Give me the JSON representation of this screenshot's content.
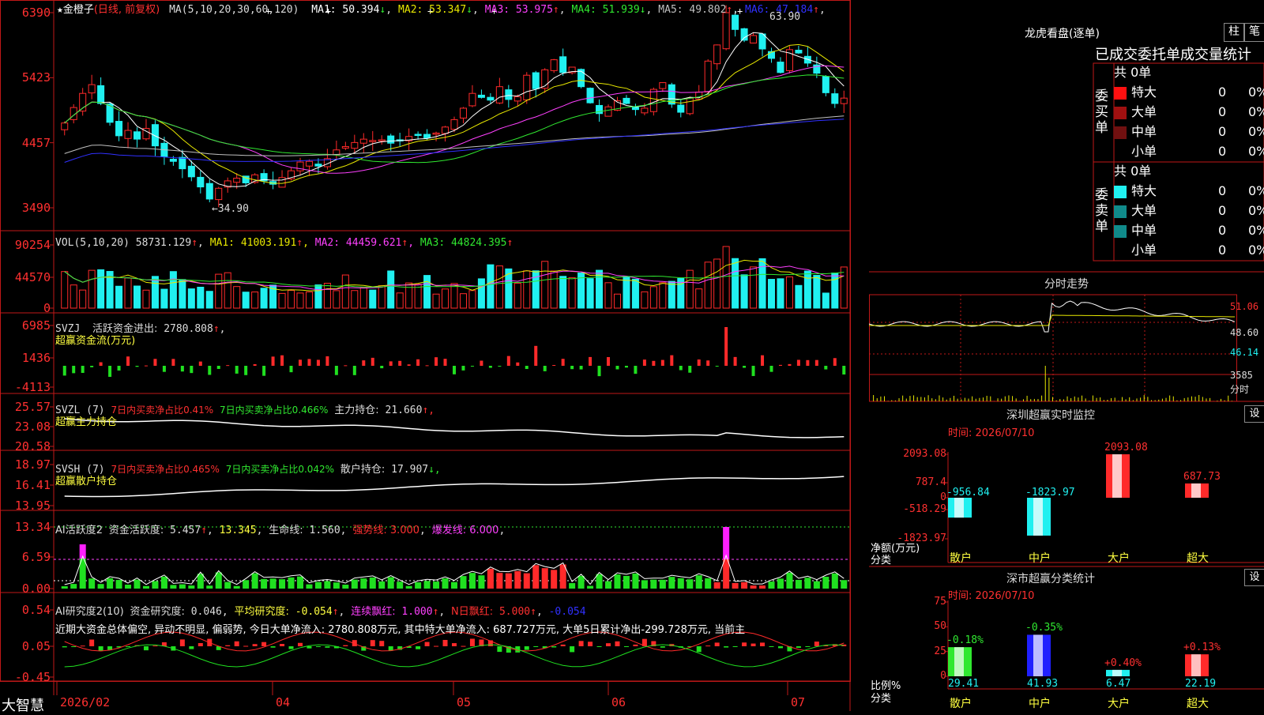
{
  "colors": {
    "up": "#ff2a2a",
    "down": "#20f0f0",
    "panel_border": "#c01818",
    "ma1": "#ffffff",
    "ma2": "#e8e800",
    "ma3": "#ff40ff",
    "ma4": "#30e830",
    "ma5": "#c0c0c0",
    "ma6": "#3030ff",
    "red_text": "#ff3030",
    "yellow_text": "#ffff40"
  },
  "stock": {
    "star": "★",
    "name": "金橙子",
    "mode": "(日线, 前复权)"
  },
  "main_panel": {
    "ma_header": "MA(5,10,20,30,60,120)",
    "ma_values": [
      {
        "label": "MA1:",
        "value": "50.394",
        "arrow": "↓",
        "color": "#ffffff"
      },
      {
        "label": "MA2:",
        "value": "53.347",
        "arrow": "↓",
        "color": "#e8e800"
      },
      {
        "label": "MA3:",
        "value": "53.975",
        "arrow": "↑",
        "color": "#ff40ff"
      },
      {
        "label": "MA4:",
        "value": "51.939",
        "arrow": "↓",
        "color": "#30e830"
      },
      {
        "label": "MA5:",
        "value": "49.802",
        "arrow": "↑",
        "color": "#c0c0c0"
      },
      {
        "label": "MA6:",
        "value": "47.184",
        "arrow": "↑",
        "color": "#3030ff"
      }
    ],
    "y_ticks": [
      "6390",
      "5423",
      "4457",
      "3490"
    ],
    "high_label": "63.90",
    "low_label": "←34.90"
  },
  "vol_panel": {
    "header": "VOL(5,10,20)",
    "value": "58731.129",
    "arrow": "↑",
    "ma": [
      {
        "label": "MA1:",
        "value": "41003.191",
        "arrow": "↑"
      },
      {
        "label": "MA2:",
        "value": "44459.621",
        "arrow": "↑"
      },
      {
        "label": "MA3:",
        "value": "44824.395",
        "arrow": "↑"
      }
    ],
    "y_ticks": [
      "90254",
      "44570",
      "0"
    ]
  },
  "svzj_panel": {
    "header": "SVZJ",
    "label": "活跃资金进出:",
    "value": "2780.808",
    "arrow": "↑",
    "subtitle": "超赢资金流(万元)",
    "y_ticks": [
      "6985",
      "1436",
      "-4113"
    ]
  },
  "svzl_panel": {
    "header": "SVZL (7)",
    "t1": "7日内买卖净占比0.41%",
    "t2": "7日内买卖净占比0.466%",
    "label": "主力持仓:",
    "value": "21.660",
    "arrow": "↑,",
    "subtitle": "超赢主力持仓",
    "y_ticks": [
      "25.57",
      "23.08",
      "20.58"
    ]
  },
  "svsh_panel": {
    "header": "SVSH (7)",
    "t1": "7日内买卖净占比0.465%",
    "t2": "7日内买卖净占比0.042%",
    "label": "散户持仓:",
    "value": "17.907",
    "arrow": "↓,",
    "subtitle": "超赢散户持仓",
    "y_ticks": [
      "18.97",
      "16.41",
      "13.95"
    ]
  },
  "ai_active_panel": {
    "header": "AI活跃度2",
    "label": "资金活跃度:",
    "value": "5.457",
    "v2": "13.345",
    "label3": "生命线:",
    "v3": "1.560",
    "t4": "强势线: 3.000",
    "t5": "爆发线: 6.000",
    "y_ticks": [
      "13.34",
      "6.59",
      "0.00"
    ]
  },
  "ai_research_panel": {
    "header": "AI研究度2(10)",
    "label": "资金研究度:",
    "value": "0.046",
    "t2": "平均研究度:",
    "v2": "-0.054",
    "t3": "连续飘红:",
    "v3": "1.000",
    "t4": "N日飘红:",
    "v4": "5.000",
    "v5": "-0.054",
    "comment": "近期大资金总体偏空, 异动不明显, 偏弱势, 今日大单净流入: 2780.808万元, 其中特大单净流入: 687.727万元, 大单5日累计净出-299.728万元, 当前主",
    "y_ticks": [
      "0.54",
      "0.05",
      "-0.45"
    ]
  },
  "x_axis": {
    "labels": [
      "2026/02",
      "04",
      "05",
      "06",
      "07"
    ],
    "brand": "大智慧"
  },
  "dragon_tiger": {
    "title": "龙虎看盘(逐单)",
    "btn1": "柱",
    "btn2": "笔",
    "header": "已成交委托单成交量统计",
    "buy": {
      "side": "委买单",
      "total": "共 0单",
      "rows": [
        {
          "label": "特大",
          "count": "0",
          "pct": "0%",
          "color": "#ff1010"
        },
        {
          "label": "大单",
          "count": "0",
          "pct": "0%",
          "color": "#a01010"
        },
        {
          "label": "中单",
          "count": "0",
          "pct": "0%",
          "color": "#701010"
        },
        {
          "label": "小单",
          "count": "0",
          "pct": "0%",
          "color": ""
        }
      ]
    },
    "sell": {
      "side": "委卖单",
      "total": "共 0单",
      "rows": [
        {
          "label": "特大",
          "count": "0",
          "pct": "0%",
          "color": "#20f0f0"
        },
        {
          "label": "大单",
          "count": "0",
          "pct": "0%",
          "color": "#108a8a"
        },
        {
          "label": "中单",
          "count": "0",
          "pct": "0%",
          "color": "#108a8a"
        },
        {
          "label": "小单",
          "count": "0",
          "pct": "0%",
          "color": ""
        }
      ]
    }
  },
  "intraday": {
    "title": "分时走势",
    "y_ticks": [
      "51.06",
      "48.60",
      "46.14",
      "3585",
      "分时"
    ]
  },
  "sz_monitor": {
    "title": "深圳超赢实时监控",
    "btn": "设",
    "time": "时间: 2026/07/10",
    "y_ticks": [
      "2093.08",
      "787.4",
      "0",
      "-518.29",
      "-1823.97"
    ],
    "ylabel1": "净额(万元)",
    "ylabel2": "分类",
    "bars": [
      {
        "cat": "散户",
        "value": -956.84,
        "label": "-956.84",
        "color": "#20f0f0"
      },
      {
        "cat": "中户",
        "value": -1823.97,
        "label": "-1823.97",
        "color": "#20f0f0"
      },
      {
        "cat": "大户",
        "value": 2093.08,
        "label": "2093.08",
        "color": "#ff2a2a"
      },
      {
        "cat": "超大",
        "value": 687.73,
        "label": "687.73",
        "color": "#ff2a2a"
      }
    ]
  },
  "sz_class": {
    "title": "深市超赢分类统计",
    "btn": "设",
    "time": "时间: 2026/07/10",
    "y_ticks": [
      "75",
      "50",
      "25",
      "0"
    ],
    "ylabel1": "比例%",
    "ylabel2": "分类",
    "bars": [
      {
        "cat": "散户",
        "value": 29.41,
        "label": "29.41",
        "change": "-0.18%",
        "color": "#30e830"
      },
      {
        "cat": "中户",
        "value": 41.93,
        "label": "41.93",
        "change": "-0.35%",
        "color": "#2020ff"
      },
      {
        "cat": "大户",
        "value": 6.47,
        "label": "6.47",
        "change": "+0.40%",
        "color": "#20f0f0"
      },
      {
        "cat": "超大",
        "value": 22.19,
        "label": "22.19",
        "change": "+0.13%",
        "color": "#ff2a2a"
      }
    ]
  },
  "chart_data": {
    "type": "candlestick",
    "title": "金橙子 (日线, 前复权)",
    "ylim": [
      34.9,
      63.9
    ],
    "y_ticks": [
      63.9,
      54.23,
      44.57,
      34.9
    ],
    "x_labels": [
      "2026/02",
      "04",
      "05",
      "06",
      "07"
    ],
    "close": [
      47.5,
      49.8,
      51.9,
      53.2,
      50.4,
      47.6,
      45.6,
      46.4,
      45.1,
      46.7,
      44.1,
      42.5,
      41.8,
      40.7,
      39.5,
      38.0,
      36.2,
      37.8,
      38.9,
      39.3,
      38.6,
      39.8,
      38.9,
      38.4,
      39.4,
      40.4,
      41.7,
      41.8,
      41.1,
      42.2,
      43.5,
      44.0,
      44.6,
      45.1,
      44.9,
      45.0,
      44.5,
      44.9,
      45.5,
      45.7,
      45.3,
      46.0,
      46.9,
      48.0,
      49.7,
      51.9,
      51.3,
      50.9,
      52.9,
      51.0,
      51.4,
      54.6,
      52.6,
      55.4,
      56.9,
      55.0,
      55.8,
      52.9,
      50.5,
      48.9,
      49.9,
      50.8,
      50.4,
      49.5,
      49.7,
      52.5,
      53.5,
      50.3,
      49.1,
      51.2,
      52.1,
      56.7,
      59.1,
      63.9,
      61.4,
      59.8,
      60.5,
      58.5,
      57.1,
      55.0,
      58.4,
      57.9,
      56.4,
      54.9,
      52.0,
      50.4,
      51.2
    ]
  },
  "series_meta": {
    "vol_scale": 90254,
    "svzj_scale": [
      6985,
      -4113
    ]
  }
}
